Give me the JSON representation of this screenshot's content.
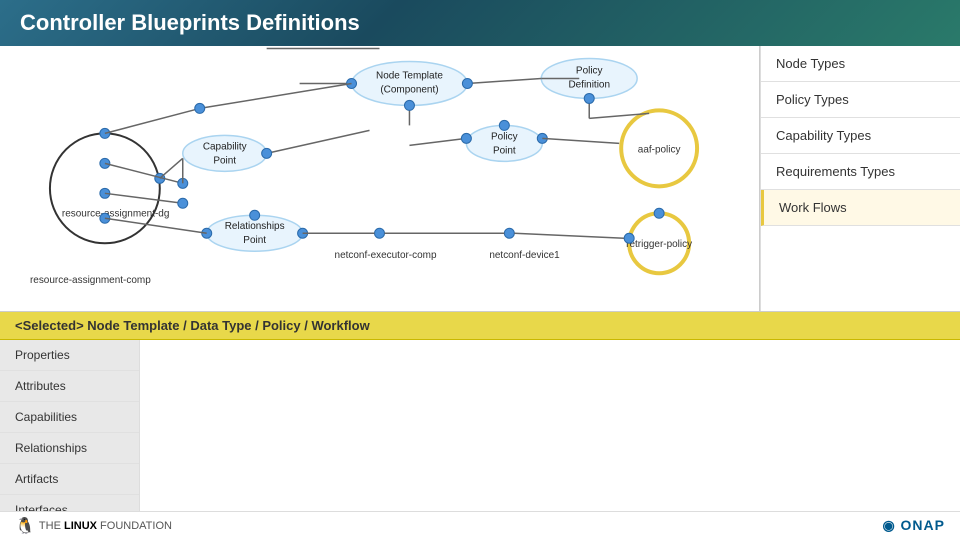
{
  "header": {
    "title": "Controller Blueprints Definitions"
  },
  "diagram": {
    "labels": {
      "nodeTemplate": "Node Template (Component)",
      "policyDefinition": "Policy Definition",
      "policyPoint": "Policy Point",
      "capabilityPoint": "Capability Point",
      "relationshipsPoint": "Relationships Point",
      "resourceAssignmentDg": "resource-assignment-dg",
      "netconfExecutorComp": "netconf-executor-comp",
      "netconfDevice1": "netconf-device1",
      "retriggerPolicy": "retrigger-policy",
      "aafPolicy": "aaf-policy",
      "resourceAssignmentComp": "resource-assignment-comp"
    }
  },
  "right_panel": {
    "items": [
      {
        "label": "Node Types",
        "active": false
      },
      {
        "label": "Policy Types",
        "active": false
      },
      {
        "label": "Capability Types",
        "active": false
      },
      {
        "label": "Requirements Types",
        "active": false
      },
      {
        "label": "Work Flows",
        "active": true
      }
    ]
  },
  "selected_bar": {
    "text": "<Selected> Node Template / Data Type / Policy / Workflow"
  },
  "left_nav": {
    "items": [
      {
        "label": "Properties"
      },
      {
        "label": "Attributes"
      },
      {
        "label": "Capabilities"
      },
      {
        "label": "Relationships"
      },
      {
        "label": "Artifacts"
      },
      {
        "label": "Interfaces"
      }
    ]
  },
  "footer": {
    "linux_foundation": "THE LINUX FOUNDATION",
    "onap_label": "ONAP"
  }
}
